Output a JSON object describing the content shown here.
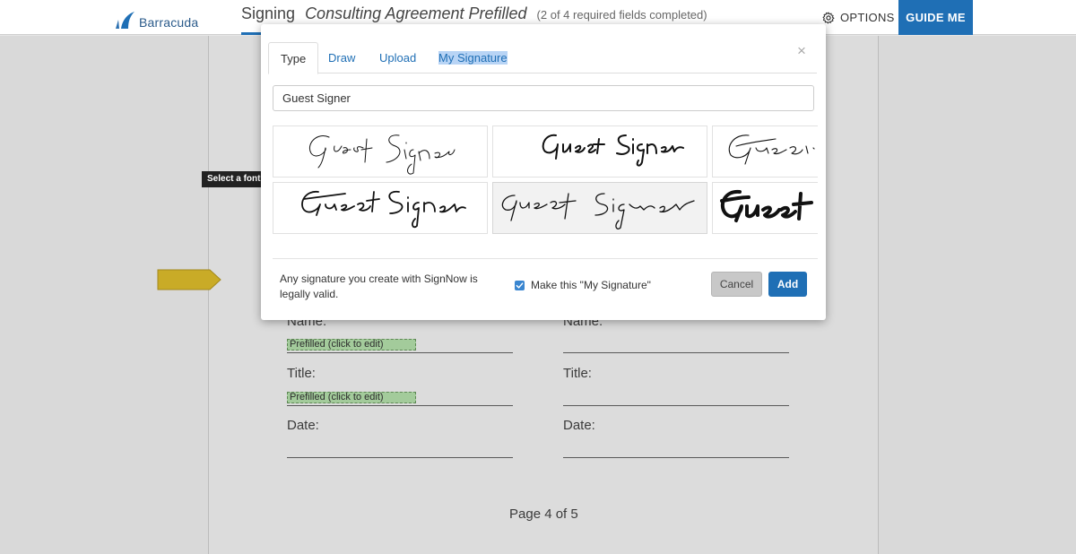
{
  "header": {
    "brand": "Barracuda",
    "signing_label": "Signing",
    "document_name": "Consulting Agreement Prefilled",
    "progress": "(2 of 4 required fields completed)",
    "options_label": "OPTIONS",
    "guide_label": "GUIDE ME",
    "brand_color": "#1f6fb5"
  },
  "document": {
    "left_fields": [
      {
        "label": "Name:",
        "value": "Prefilled (click to edit)"
      },
      {
        "label": "Title:",
        "value": "Prefilled (click to edit)"
      },
      {
        "label": "Date:"
      }
    ],
    "right_fields": [
      {
        "label": "Name:"
      },
      {
        "label": "Title:"
      },
      {
        "label": "Date:"
      }
    ],
    "page_indicator": "Page 4 of 5"
  },
  "tooltip": "Select a font",
  "modal": {
    "tabs": [
      "Type",
      "Draw",
      "Upload",
      "My Signature"
    ],
    "active_tab": "Type",
    "close_icon": "×",
    "name_value": "Guest Signer",
    "legal_text": "Any signature you create with SignNow is legally valid.",
    "make_default_label": "Make this \"My Signature\"",
    "make_default_checked": true,
    "cancel_label": "Cancel",
    "add_label": "Add"
  }
}
